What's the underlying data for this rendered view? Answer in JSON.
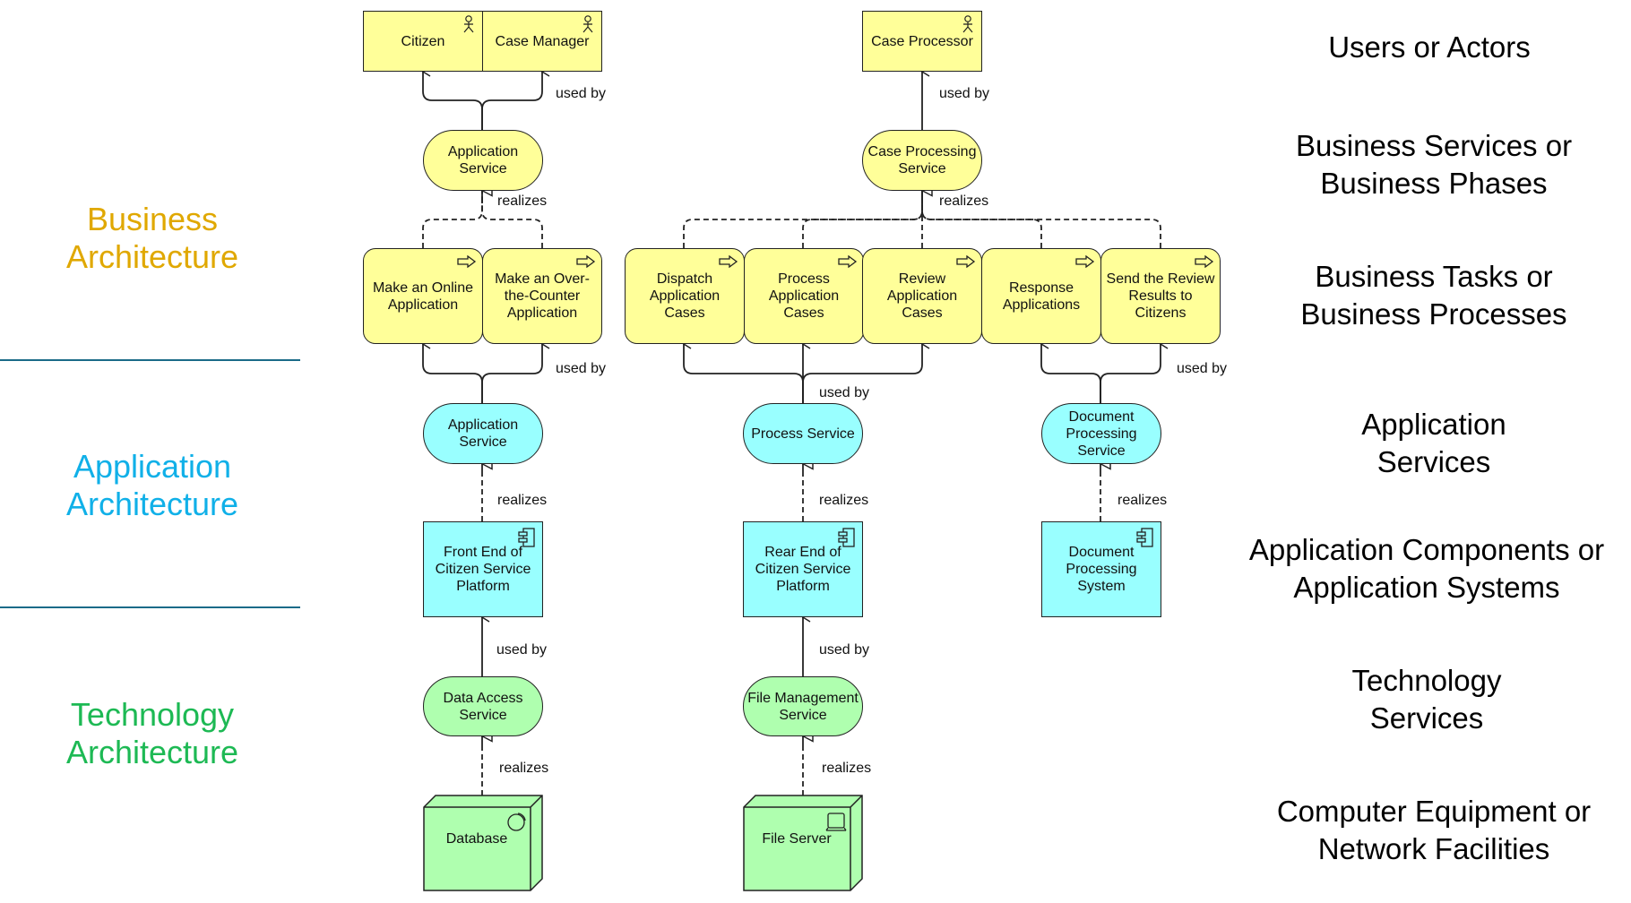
{
  "colors": {
    "business_fill": "#ffff99",
    "application_fill": "#99ffff",
    "technology_fill": "#afffaf",
    "business_label": "#e0a800",
    "application_label": "#10b0e8",
    "technology_label": "#1db954",
    "divider": "#1a6b88"
  },
  "layers": {
    "business": "Business Architecture",
    "application": "Application Architecture",
    "technology": "Technology Architecture"
  },
  "rows": {
    "actors": [
      "Users or Actors"
    ],
    "business_services": [
      "Business Services or",
      "Business Phases"
    ],
    "business_processes": [
      "Business Tasks or",
      "Business Processes"
    ],
    "application_services": [
      "Application",
      "Services"
    ],
    "application_components": [
      "Application Components or",
      "Application Systems"
    ],
    "technology_services": [
      "Technology",
      "Services"
    ],
    "nodes": [
      "Computer Equipment or",
      "Network Facilities"
    ]
  },
  "nodes": {
    "citizen": "Citizen",
    "case_manager": "Case Manager",
    "case_processor": "Case Processor",
    "application_service_biz": "Application Service",
    "case_processing_service": "Case Processing Service",
    "make_online": "Make an Online Application",
    "make_otc": "Make an Over-the-Counter Application",
    "dispatch": "Dispatch Application Cases",
    "process": "Process Application Cases",
    "review": "Review Application Cases",
    "response": "Response Applications",
    "send_results": "Send the Review Results to Citizens",
    "application_service_app": "Application Service",
    "process_service": "Process Service",
    "document_processing_service": "Document Processing Service",
    "front_end": "Front End of Citizen Service Platform",
    "rear_end": "Rear End of Citizen Service Platform",
    "document_processing_system": "Document Processing System",
    "data_access_service": "Data Access Service",
    "file_management_service": "File Management Service",
    "database": "Database",
    "file_server": "File Server"
  },
  "edge_labels": {
    "used_by": "used by",
    "realizes": "realizes"
  }
}
